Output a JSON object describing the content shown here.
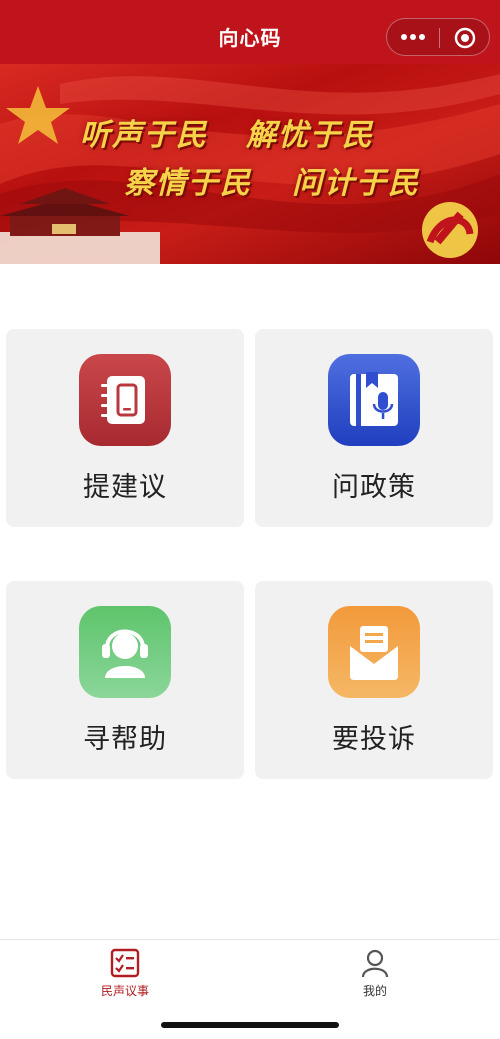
{
  "navbar": {
    "title": "向心码",
    "background_color": "#c0141c",
    "more_icon": "more-dots-icon",
    "close_icon": "target-close-icon"
  },
  "banner": {
    "slogans": [
      "听声于民",
      "解忧于民",
      "察情于民",
      "问计于民"
    ],
    "text_color": "#f7d34a"
  },
  "cards": [
    {
      "label": "提建议",
      "icon": "notebook-phone-icon",
      "color": "#b8383d"
    },
    {
      "label": "问政策",
      "icon": "book-microphone-icon",
      "color": "#2f4fd0"
    },
    {
      "label": "寻帮助",
      "icon": "headset-person-icon",
      "color": "#6ccb7a"
    },
    {
      "label": "要投诉",
      "icon": "envelope-letter-icon",
      "color": "#f3a64c"
    }
  ],
  "tabbar": {
    "items": [
      {
        "label": "民声议事",
        "icon": "checklist-icon",
        "active": true,
        "color": "#b21d22"
      },
      {
        "label": "我的",
        "icon": "user-icon",
        "active": false,
        "color": "#333333"
      }
    ]
  }
}
